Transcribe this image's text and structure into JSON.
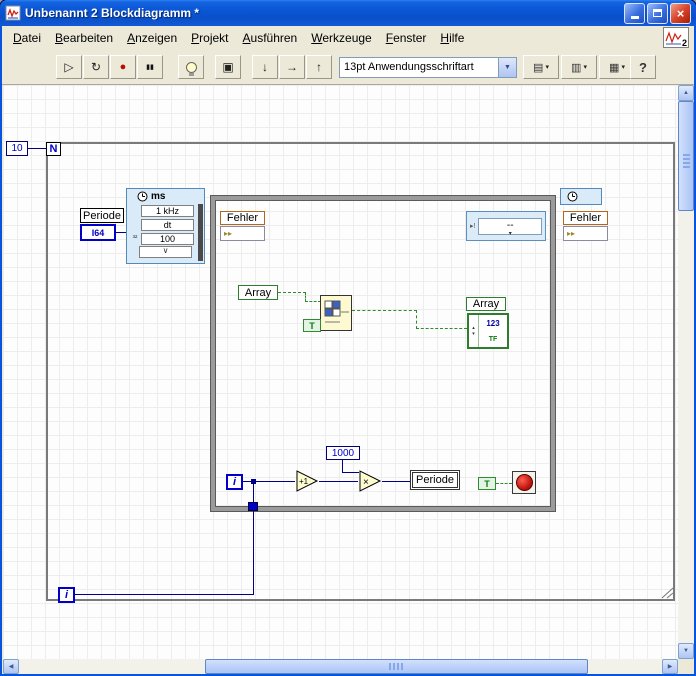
{
  "window": {
    "title": "Unbenannt 2 Blockdiagramm *"
  },
  "titlebar_buttons": {
    "close_glyph": "×"
  },
  "menu": {
    "items": [
      {
        "label": "Datei"
      },
      {
        "label": "Bearbeiten"
      },
      {
        "label": "Anzeigen"
      },
      {
        "label": "Projekt"
      },
      {
        "label": "Ausführen"
      },
      {
        "label": "Werkzeuge"
      },
      {
        "label": "Fenster"
      },
      {
        "label": "Hilfe"
      }
    ]
  },
  "toolbar": {
    "font_selector": "13pt Anwendungsschriftart",
    "help_label": "?"
  },
  "icons": {
    "run": "▷",
    "run_continuous": "↻",
    "abort": "●",
    "pause": "▮▮",
    "retain_wires": "▣",
    "step_into": "↓",
    "step_over": "→",
    "step_out": "↑",
    "align_objects": "▤",
    "distribute_objects": "▥",
    "reorder_objects": "▦",
    "dropdown_arrow": "▼",
    "small_arrow": "▾",
    "chevron_down": "∨",
    "scroll_up": "▲",
    "scroll_down": "▼",
    "scroll_left": "◀",
    "scroll_right": "▶",
    "error_in_glyph": "▸▸",
    "error_node_glyph": "▸!",
    "vi_badge": "2"
  },
  "diagram": {
    "for_loop": {
      "count_terminal": "N",
      "count_constant": "10",
      "iteration": "i"
    },
    "periode_control": {
      "label": "Periode",
      "datatype": "I64"
    },
    "timing_node": {
      "title": "ms",
      "rows": [
        {
          "icon": "",
          "value": "1 kHz"
        },
        {
          "icon": "",
          "value": "dt"
        },
        {
          "icon": "³²",
          "value": "100"
        }
      ]
    },
    "while_loop": {
      "error_in": "Fehler",
      "error_out": "Fehler",
      "display_value": "--",
      "array_in": "Array",
      "array_out": "Array",
      "array_digits": "123",
      "array_bool": "TF",
      "iteration": "i",
      "constant_1000": "1000",
      "increment_label": "+1",
      "multiply_label": "×",
      "periode_indicator": "Periode",
      "bool_constant": "T"
    }
  },
  "colors": {
    "int_wire": "#000084",
    "bool_wire": "#2e8b2e",
    "titlebar_blue": "#0a56d6",
    "menubar_bg": "#ece9d8"
  }
}
